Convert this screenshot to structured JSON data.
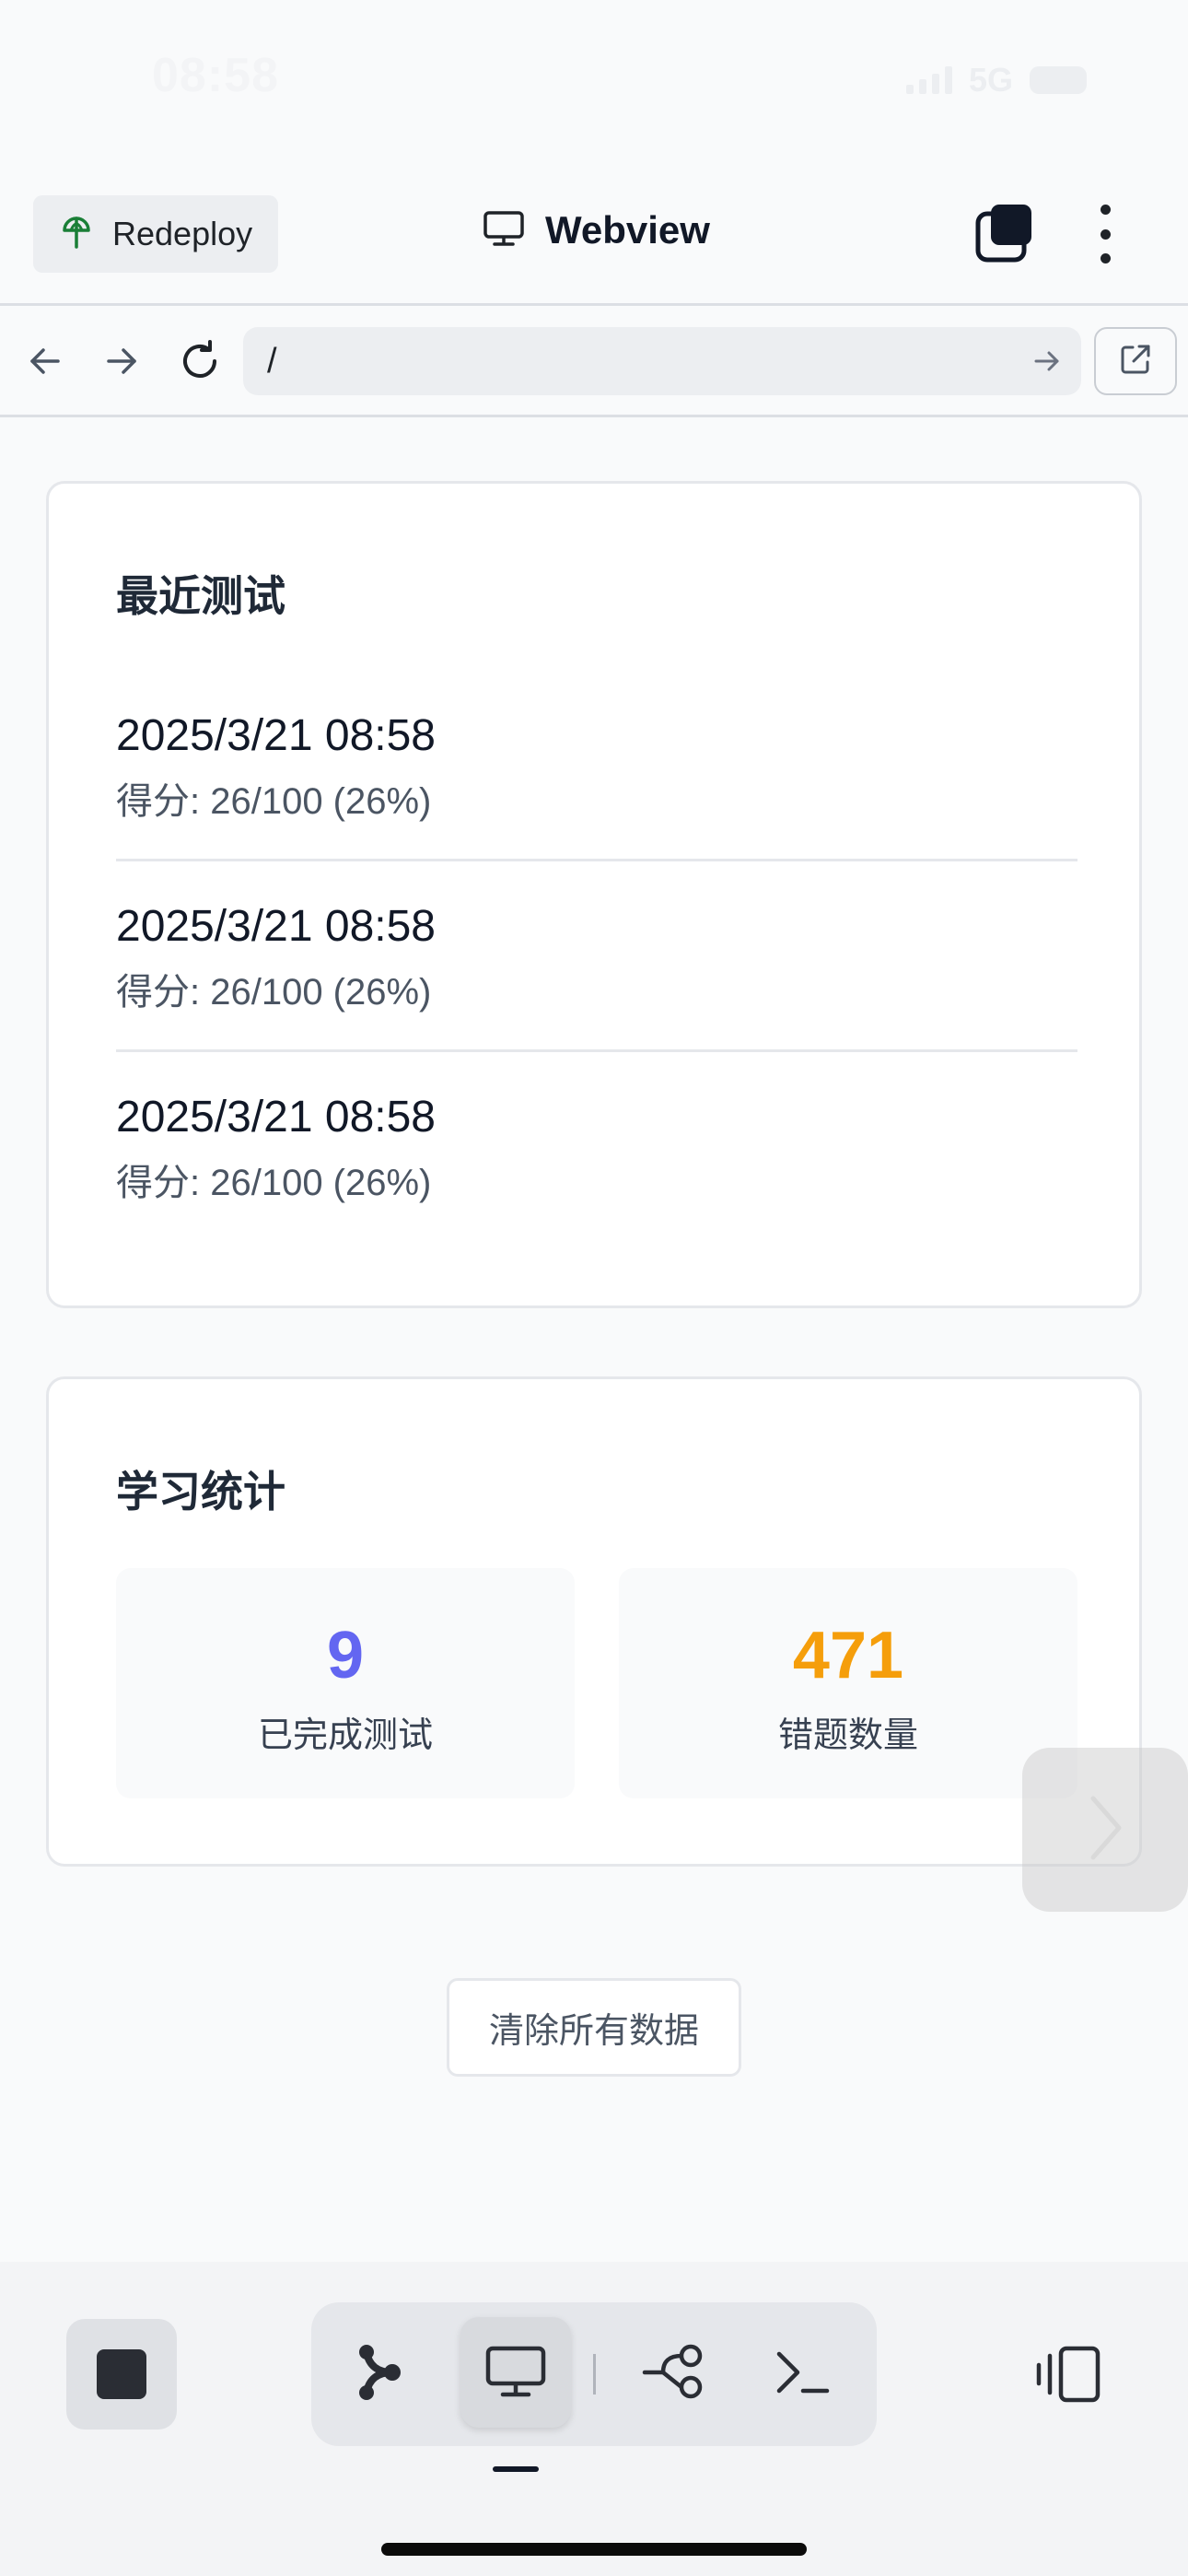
{
  "status_bar": {
    "time": "08:58",
    "network": "5G"
  },
  "header": {
    "redeploy_label": "Redeploy",
    "title": "Webview"
  },
  "browser": {
    "url": "/"
  },
  "recent_tests": {
    "title": "最近测试",
    "items": [
      {
        "date": "2025/3/21 08:58",
        "score": "得分: 26/100 (26%)"
      },
      {
        "date": "2025/3/21 08:58",
        "score": "得分: 26/100 (26%)"
      },
      {
        "date": "2025/3/21 08:58",
        "score": "得分: 26/100 (26%)"
      }
    ]
  },
  "study_stats": {
    "title": "学习统计",
    "completed": {
      "value": "9",
      "label": "已完成测试",
      "color": "#6366f1"
    },
    "mistakes": {
      "value": "471",
      "label": "错题数量",
      "color": "#f59e0b"
    }
  },
  "clear_button_label": "清除所有数据",
  "icons": {
    "redeploy": "redeploy-icon",
    "webview": "monitor-icon",
    "stack": "stacked-windows-icon",
    "more": "more-vertical-icon",
    "back": "arrow-left-icon",
    "forward": "arrow-right-icon",
    "reload": "reload-icon",
    "go": "arrow-right-small-icon",
    "external": "open-external-icon",
    "side_arrow": "chevron-right-icon",
    "stop": "stop-icon",
    "deploy": "deploy-icon",
    "monitor": "monitor-icon",
    "git": "git-branch-icon",
    "terminal": "terminal-icon",
    "panel": "panel-toggle-icon"
  }
}
